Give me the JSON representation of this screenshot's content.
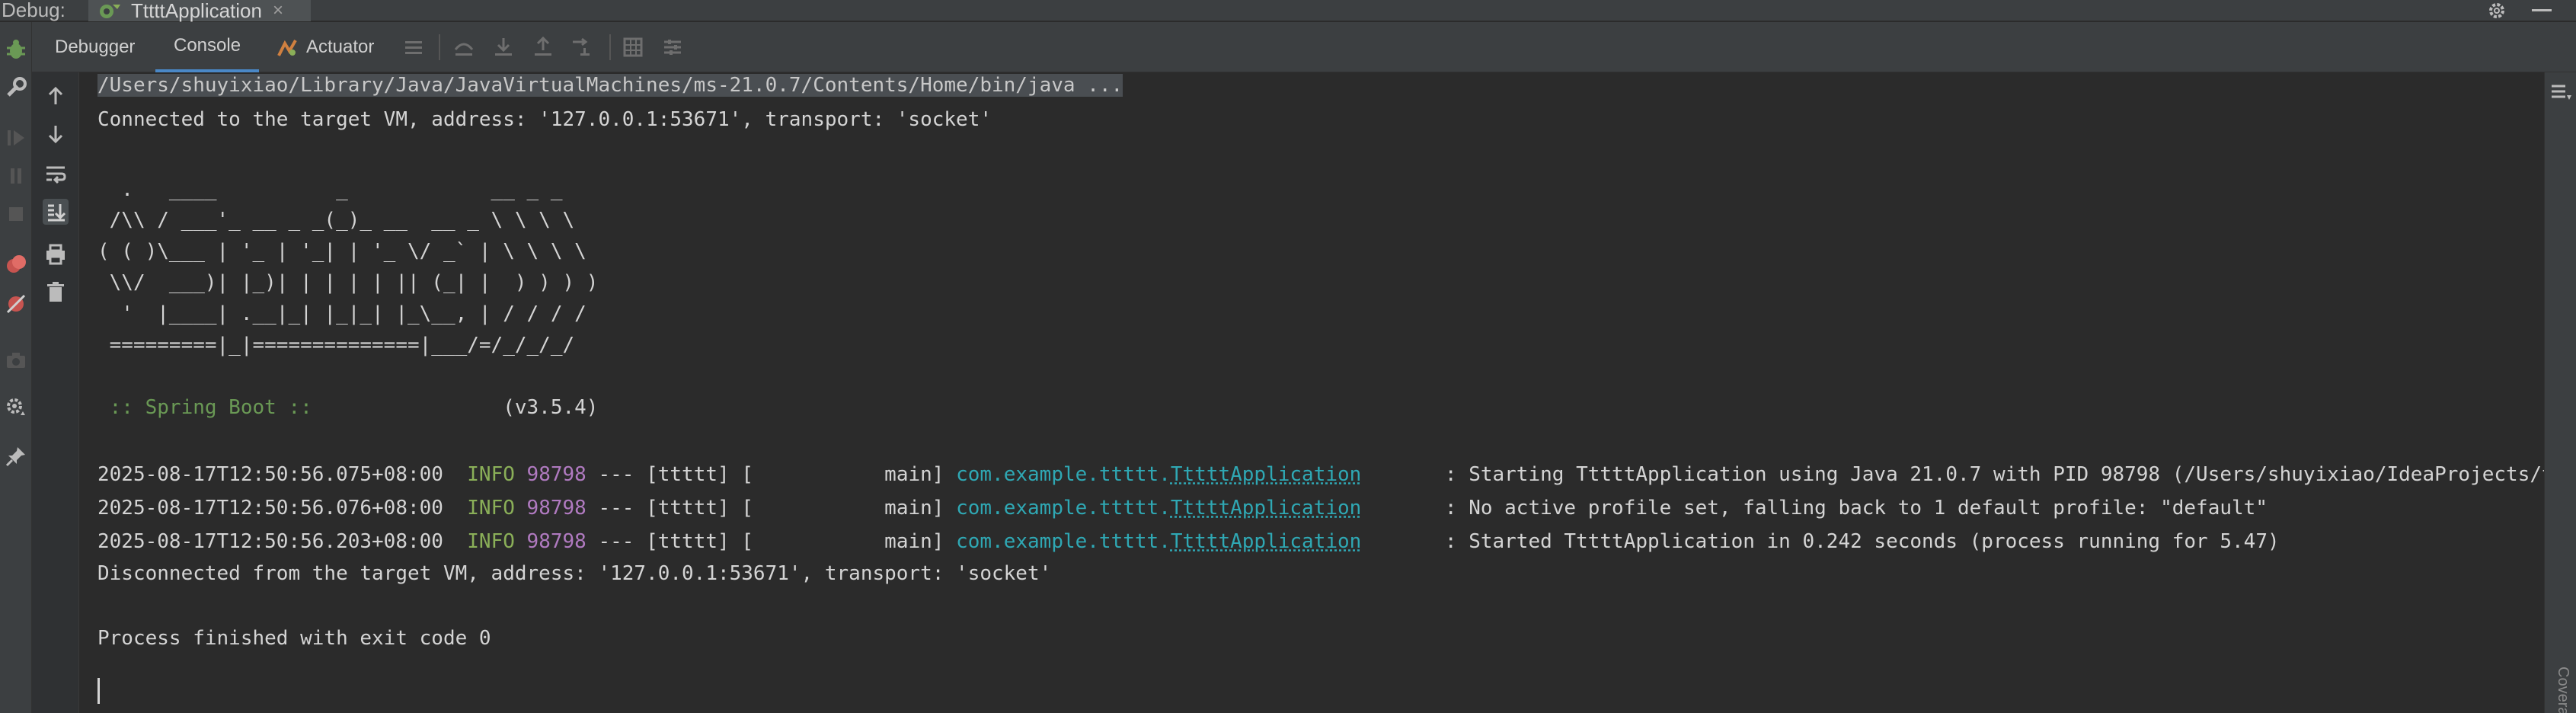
{
  "window": {
    "debug_label": "Debug:",
    "run_tab_title": "TttttApplication",
    "run_tab_close": "×"
  },
  "tabs": [
    {
      "label": "Debugger"
    },
    {
      "label": "Console"
    },
    {
      "label": "Actuator"
    }
  ],
  "console": {
    "cmd_line": "/Users/shuyixiao/Library/Java/JavaVirtualMachines/ms-21.0.7/Contents/Home/bin/java ...",
    "connected": "Connected to the target VM, address: '127.0.0.1:53671', transport: 'socket'",
    "banner": [
      "  .   ____          _            __ _ _",
      " /\\\\ / ___'_ __ _ _(_)_ __  __ _ \\ \\ \\ \\",
      "( ( )\\___ | '_ | '_| | '_ \\/ _` | \\ \\ \\ \\",
      " \\\\/  ___)| |_)| | | | | || (_| |  ) ) ) )",
      "  '  |____| .__|_| |_|_| |_\\__, | / / / /",
      " =========|_|==============|___/=/_/_/_/"
    ],
    "spring_boot_label": " :: Spring Boot :: ",
    "spring_boot_version": "               (v3.5.4)",
    "logs": [
      {
        "timestamp": "2025-08-17T12:50:56.075+08:00",
        "level": "INFO",
        "pid": "98798",
        "mid": " --- [ttttt] [           main] ",
        "pkg": "com.example.ttttt.",
        "cls": "TttttApplication",
        "pad": "       ",
        "msg": ": Starting TttttApplication using Java 21.0.7 with PID 98798 (/Users/shuyixiao/IdeaProjects/ttt"
      },
      {
        "timestamp": "2025-08-17T12:50:56.076+08:00",
        "level": "INFO",
        "pid": "98798",
        "mid": " --- [ttttt] [           main] ",
        "pkg": "com.example.ttttt.",
        "cls": "TttttApplication",
        "pad": "       ",
        "msg": ": No active profile set, falling back to 1 default profile: \"default\""
      },
      {
        "timestamp": "2025-08-17T12:50:56.203+08:00",
        "level": "INFO",
        "pid": "98798",
        "mid": " --- [ttttt] [           main] ",
        "pkg": "com.example.ttttt.",
        "cls": "TttttApplication",
        "pad": "       ",
        "msg": ": Started TttttApplication in 0.242 seconds (process running for 5.47)"
      }
    ],
    "disconnected": "Disconnected from the target VM, address: '127.0.0.1:53671', transport: 'socket'",
    "exit": "Process finished with exit code 0"
  },
  "right_strip_label": "Coverage",
  "colors": {
    "background": "#2b2b2b",
    "toolbar": "#3c3f41",
    "accent_tab": "#4a88c7",
    "info": "#8aaf58",
    "pid": "#b07ac0",
    "class": "#2fa8b4",
    "spring": "#6a9955"
  }
}
